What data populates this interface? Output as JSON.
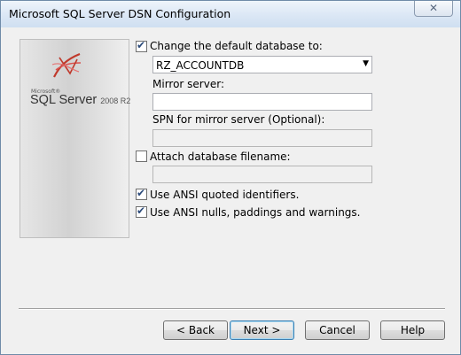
{
  "window": {
    "title": "Microsoft SQL Server DSN Configuration",
    "close_glyph": "✕"
  },
  "banner": {
    "logo_small": "Microsoft®",
    "logo_main": "SQL Server",
    "logo_version": "2008 R2"
  },
  "options": {
    "change_default_db": {
      "label": "Change the default database to:",
      "checked": true
    },
    "database_value": "RZ_ACCOUNTDB",
    "mirror_label": "Mirror server:",
    "mirror_value": "",
    "spn_label": "SPN for mirror server (Optional):",
    "spn_value": "",
    "attach_db": {
      "label": "Attach database filename:",
      "checked": false
    },
    "attach_value": "",
    "ansi_quoted": {
      "label": "Use ANSI quoted identifiers.",
      "checked": true
    },
    "ansi_nulls": {
      "label": "Use ANSI nulls, paddings and warnings.",
      "checked": true
    }
  },
  "buttons": {
    "back": "< Back",
    "next": "Next >",
    "cancel": "Cancel",
    "help": "Help"
  },
  "icons": {
    "checkmark": "✔",
    "dropdown_arrow": "▼"
  }
}
